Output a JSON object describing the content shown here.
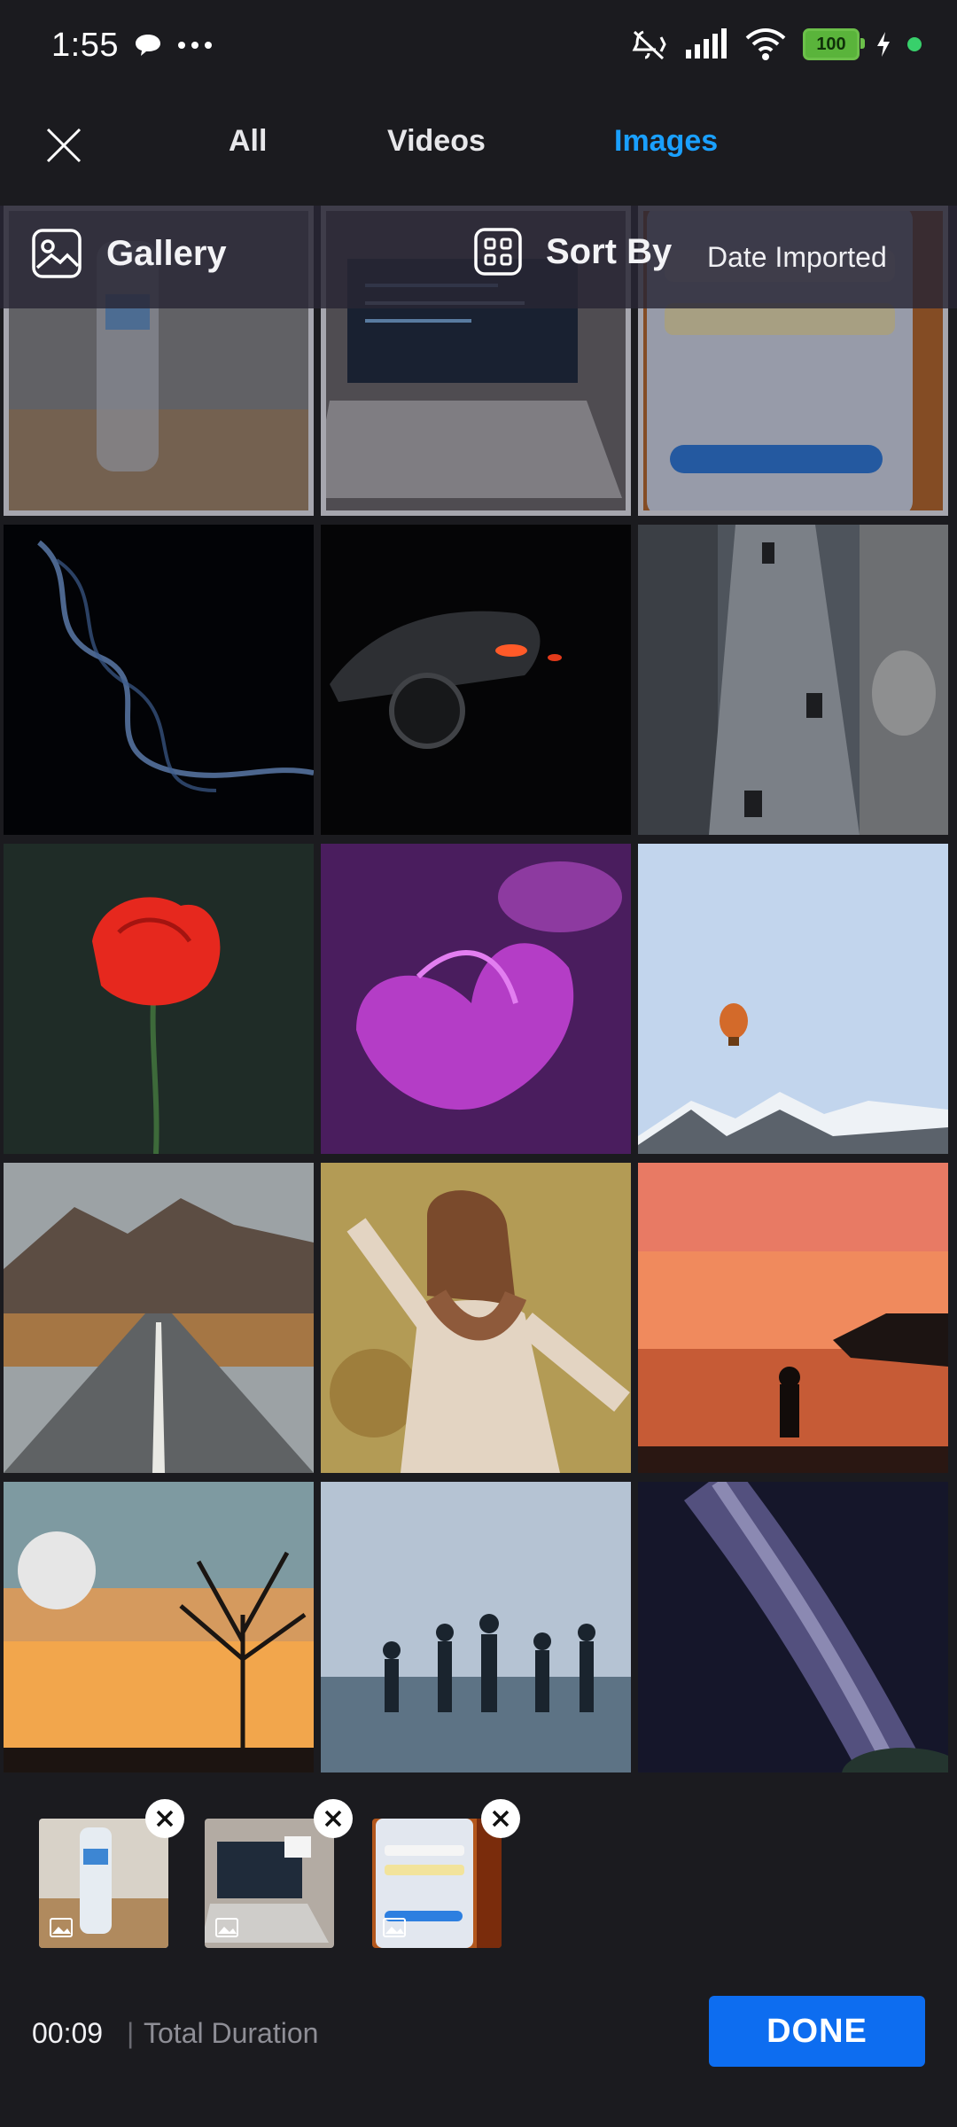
{
  "status_bar": {
    "time": "1:55",
    "battery": "100"
  },
  "tabs": [
    {
      "label": "All"
    },
    {
      "label": "Videos"
    },
    {
      "label": "Images"
    }
  ],
  "toolbar": {
    "gallery_label": "Gallery",
    "sort_label": "Sort By",
    "sort_value": "Date Imported"
  },
  "grid": {
    "selected_count": 3,
    "items": [
      {
        "subject": "water bottle on desk",
        "selected": true
      },
      {
        "subject": "laptop with code",
        "selected": true
      },
      {
        "subject": "phone screen sign up",
        "selected": true
      },
      {
        "subject": "smoke on black"
      },
      {
        "subject": "dark sports car"
      },
      {
        "subject": "city street from above"
      },
      {
        "subject": "red poppy"
      },
      {
        "subject": "purple flower"
      },
      {
        "subject": "hot air balloon over mountains"
      },
      {
        "subject": "mountain road"
      },
      {
        "subject": "woman in autumn"
      },
      {
        "subject": "sunset beach silhouette"
      },
      {
        "subject": "moon and tree at dusk"
      },
      {
        "subject": "people jumping at beach"
      },
      {
        "subject": "milky way"
      }
    ]
  },
  "footer": {
    "duration": "00:09",
    "separator": "|",
    "duration_label": "Total Duration",
    "done_label": "DONE"
  },
  "colors": {
    "background": "#1b1b1f",
    "active_tab": "#1aa0ff",
    "done_button": "#0d6df0"
  }
}
